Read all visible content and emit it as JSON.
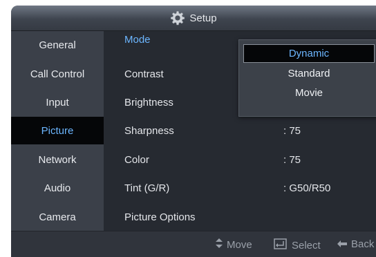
{
  "header": {
    "title": "Setup",
    "icon": "gear-icon"
  },
  "sidebar": {
    "items": [
      {
        "label": "General"
      },
      {
        "label": "Call Control"
      },
      {
        "label": "Input"
      },
      {
        "label": "Picture",
        "active": true
      },
      {
        "label": "Network"
      },
      {
        "label": "Audio"
      },
      {
        "label": "Camera"
      }
    ]
  },
  "settings": {
    "rows": [
      {
        "label": "Mode",
        "value": ""
      },
      {
        "label": "Contrast",
        "value": ""
      },
      {
        "label": "Brightness",
        "value": ""
      },
      {
        "label": "Sharpness",
        "value": ": 75"
      },
      {
        "label": "Color",
        "value": ": 75"
      },
      {
        "label": "Tint (G/R)",
        "value": ": G50/R50"
      },
      {
        "label": "Picture Options",
        "value": ""
      }
    ]
  },
  "dropdown": {
    "options": [
      "Dynamic",
      "Standard",
      "Movie"
    ],
    "selected": "Dynamic"
  },
  "footer": {
    "move": "Move",
    "select": "Select",
    "back": "Back"
  },
  "colors": {
    "accent": "#6cb6ff",
    "background": "#262a31",
    "sidebar": "#3b4049"
  }
}
